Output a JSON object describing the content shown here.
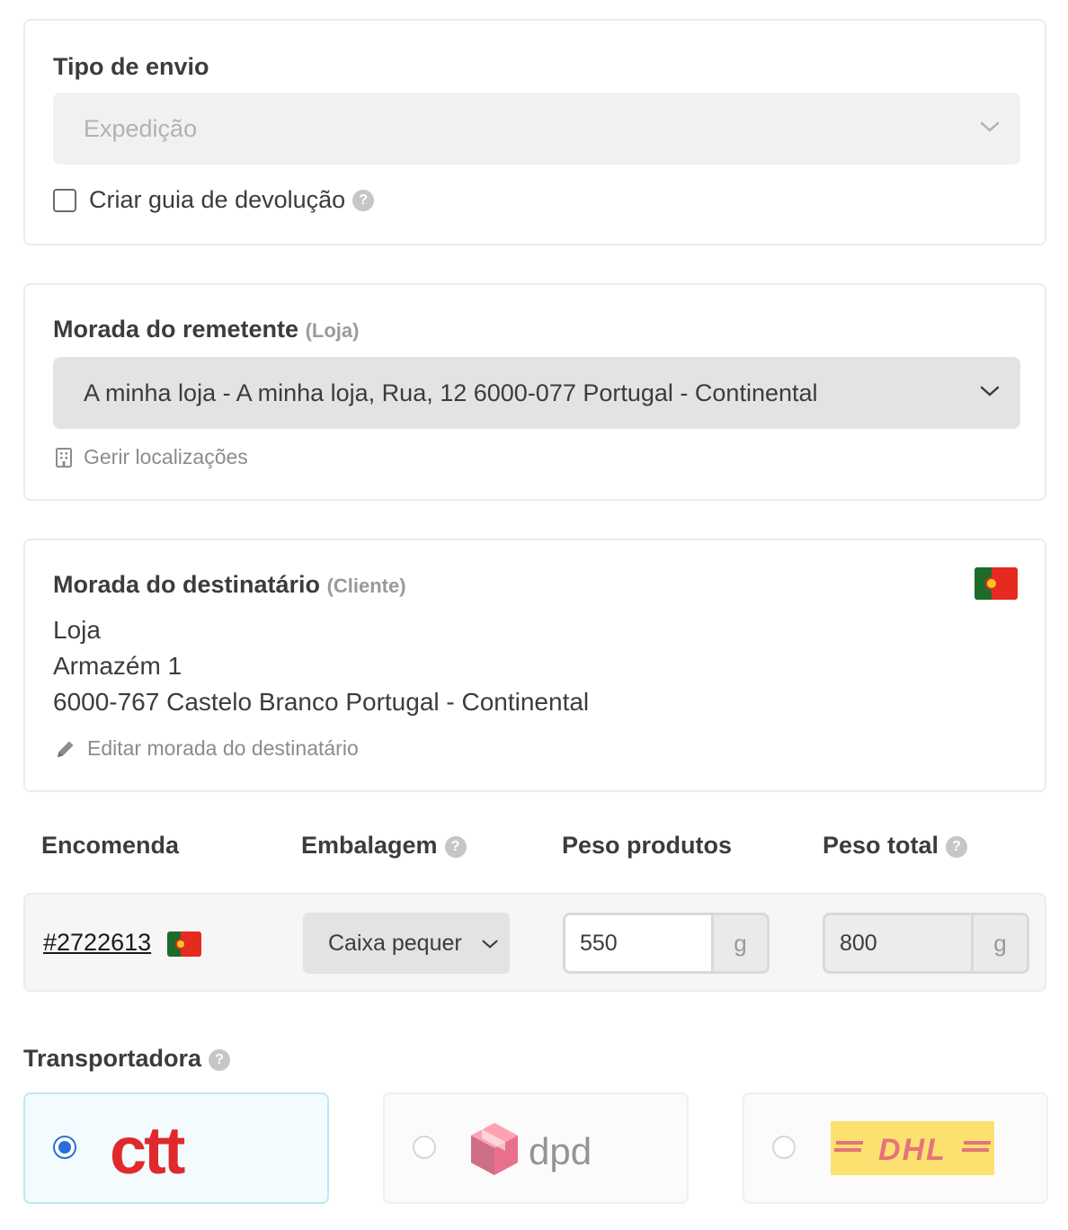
{
  "shipping_type": {
    "heading": "Tipo de envio",
    "selected": "Expedição",
    "return_label_checkbox": "Criar guia de devolução",
    "return_label_checked": false
  },
  "sender": {
    "heading": "Morada do remetente",
    "heading_tag": "(Loja)",
    "selected": "A minha loja - A minha loja, Rua, 12 6000-077 Portugal - Continental",
    "manage_link": "Gerir localizações"
  },
  "recipient": {
    "heading": "Morada do destinatário",
    "heading_tag": "(Cliente)",
    "lines": [
      "Loja",
      "Armazém 1",
      "6000-767 Castelo Branco Portugal - Continental"
    ],
    "edit_link": "Editar morada do destinatário",
    "country_flag": "flag-portugal-icon"
  },
  "order_table": {
    "columns": [
      "Encomenda",
      "Embalagem",
      "Peso produtos",
      "Peso total"
    ],
    "order_number": "#2722613",
    "packaging": "Caixa pequer",
    "product_weight": "550",
    "product_weight_unit": "g",
    "total_weight": "800",
    "total_weight_unit": "g"
  },
  "carriers": {
    "heading": "Transportadora",
    "options": [
      {
        "name": "ctt",
        "selected": true
      },
      {
        "name": "dpd",
        "selected": false
      },
      {
        "name": "DHL",
        "selected": false
      }
    ]
  },
  "colors": {
    "accent": "#2a6edb",
    "ctt_red": "#e0282d",
    "dhl_yellow": "#ffcc00",
    "dhl_red": "#d40511"
  }
}
